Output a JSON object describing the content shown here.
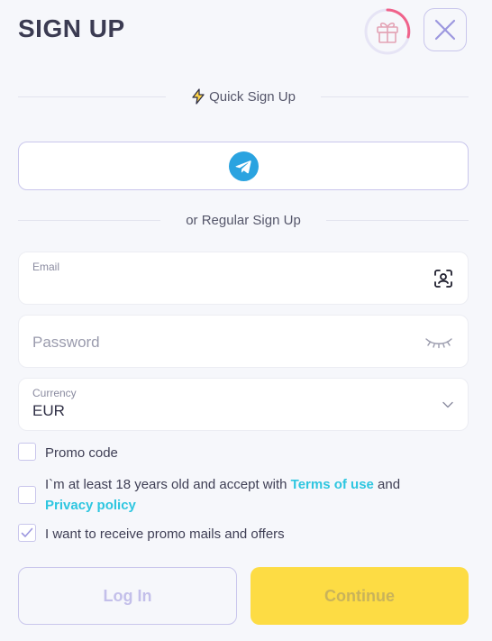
{
  "header": {
    "title": "SIGN UP",
    "gift_icon": "gift-icon",
    "close_icon": "close-icon"
  },
  "quick_signup": {
    "label": "Quick Sign Up",
    "icon": "lightning-icon",
    "telegram_icon": "telegram-icon"
  },
  "regular_signup": {
    "label": "or Regular Sign Up"
  },
  "email": {
    "label": "Email",
    "value": "",
    "icon": "face-scan-icon"
  },
  "password": {
    "placeholder": "Password",
    "icon": "eye-closed-icon"
  },
  "currency": {
    "label": "Currency",
    "value": "EUR",
    "icon": "chevron-down-icon"
  },
  "checks": {
    "promo_code": {
      "label": "Promo code",
      "checked": false
    },
    "terms": {
      "text_before": "I`m at least 18 years old and accept with ",
      "terms_link": "Terms of use",
      "text_middle": " and ",
      "privacy_link": "Privacy policy",
      "checked": false
    },
    "promo_mails": {
      "label": "I want to receive promo mails and offers",
      "checked": true
    }
  },
  "buttons": {
    "login": "Log In",
    "continue": "Continue"
  },
  "colors": {
    "accent_link": "#2ec6e0",
    "continue_bg": "#fddc44",
    "border": "#c9c6ec",
    "background": "#f6f7fb"
  }
}
